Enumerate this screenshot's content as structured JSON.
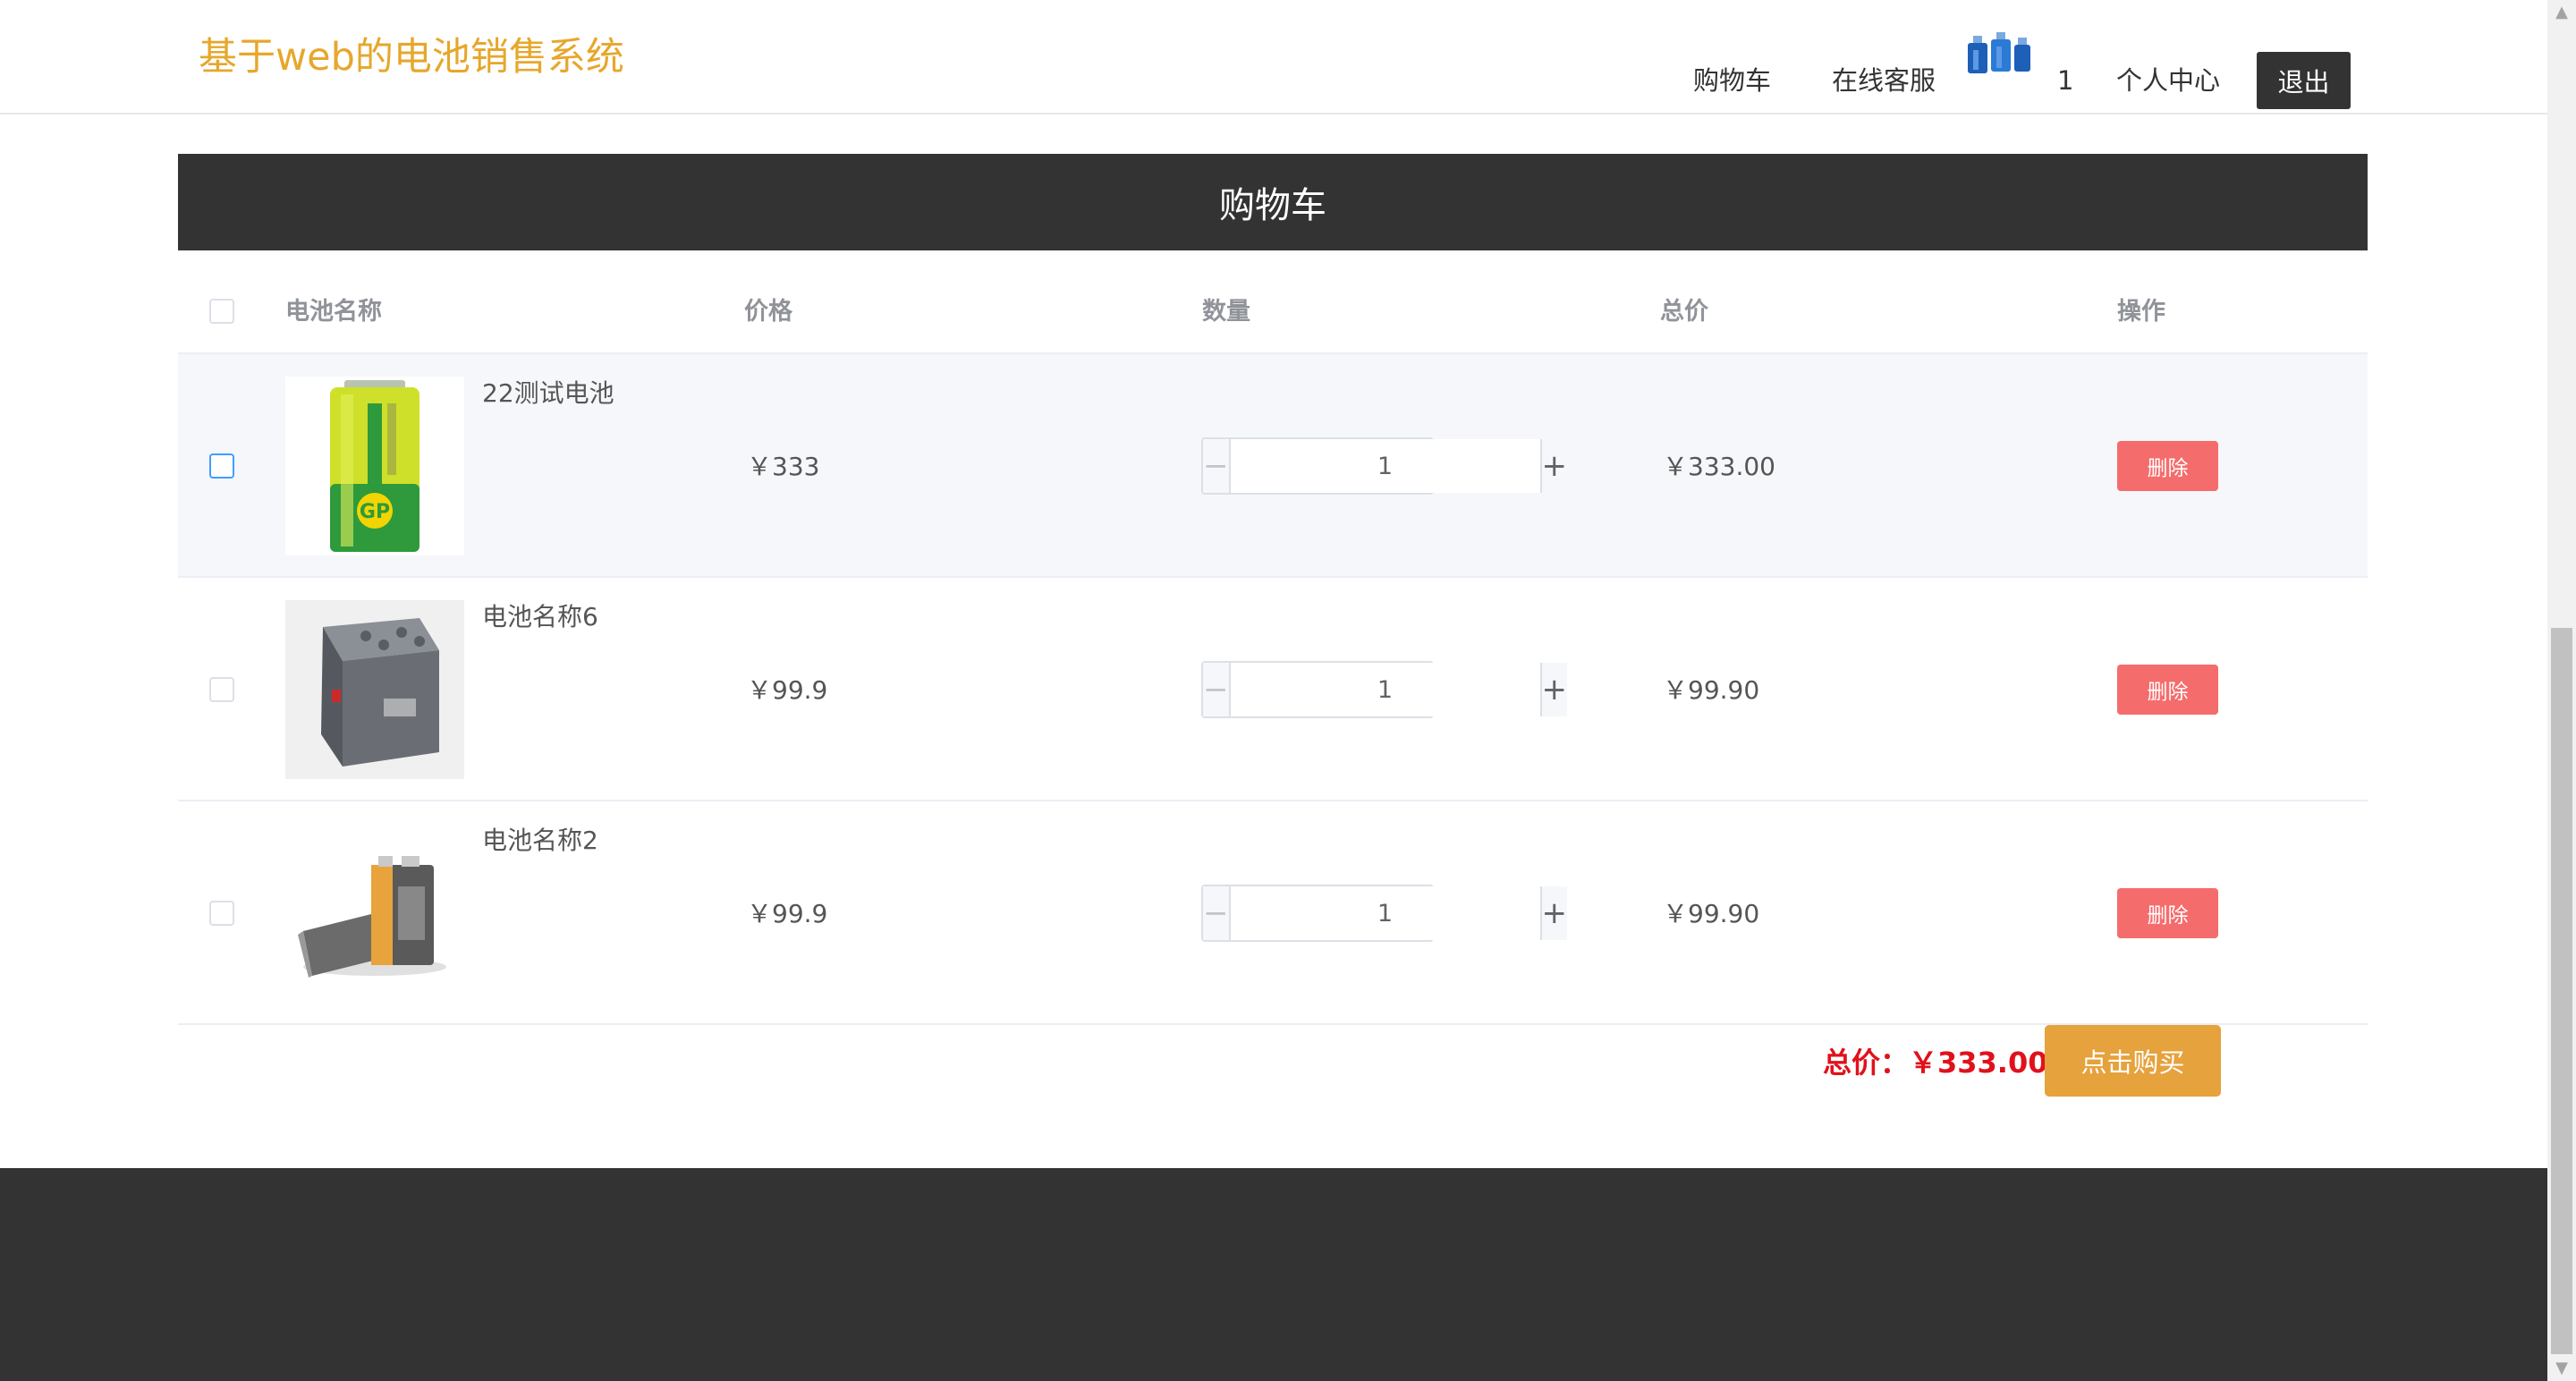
{
  "header": {
    "logo_text": "基于web的电池销售系统",
    "nav": {
      "cart": "购物车",
      "service": "在线客服",
      "cart_count": "1",
      "profile": "个人中心",
      "logout": "退出"
    }
  },
  "cart": {
    "title": "购物车",
    "columns": [
      "电池名称",
      "价格",
      "数量",
      "总价",
      "操作"
    ],
    "items": [
      {
        "name": "22测试电池",
        "price": "￥333",
        "quantity": "1",
        "total": "￥333.00",
        "delete_label": "删除",
        "checked": false
      },
      {
        "name": "电池名称6",
        "price": "￥99.9",
        "quantity": "1",
        "total": "￥99.90",
        "delete_label": "删除",
        "checked": false
      },
      {
        "name": "电池名称2",
        "price": "￥99.9",
        "quantity": "1",
        "total": "￥99.90",
        "delete_label": "删除",
        "checked": false
      }
    ],
    "summary_label": "总价：￥333.00",
    "buy_label": "点击购买"
  },
  "colors": {
    "accent": "#e6a72c",
    "dark": "#333333",
    "danger": "#f56c6c",
    "buy": "#e6a23c",
    "total_red": "#e0111b"
  }
}
